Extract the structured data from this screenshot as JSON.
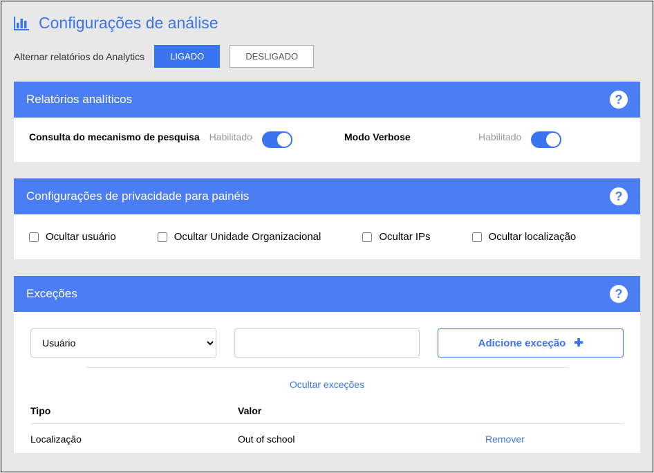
{
  "page": {
    "title": "Configurações de análise",
    "toggle_label": "Alternar relatórios do Analytics",
    "toggle_on": "LIGADO",
    "toggle_off": "DESLIGADO"
  },
  "reports_panel": {
    "title": "Relatórios analíticos",
    "search_engine": {
      "label": "Consulta do mecanismo de pesquisa",
      "state": "Habilitado"
    },
    "verbose": {
      "label": "Modo Verbose",
      "state": "Habilitado"
    }
  },
  "privacy_panel": {
    "title": "Configurações de privacidade para painéis",
    "options": {
      "hide_user": "Ocultar usuário",
      "hide_org": "Ocultar Unidade Organizacional",
      "hide_ips": "Ocultar IPs",
      "hide_location": "Ocultar localização"
    }
  },
  "exceptions_panel": {
    "title": "Exceções",
    "select_value": "Usuário",
    "add_button": "Adicione exceção",
    "hide_link": "Ocultar exceções",
    "table": {
      "col_tipo": "Tipo",
      "col_valor": "Valor",
      "rows": [
        {
          "tipo": "Localização",
          "valor": "Out of school",
          "action": "Remover"
        }
      ]
    }
  }
}
